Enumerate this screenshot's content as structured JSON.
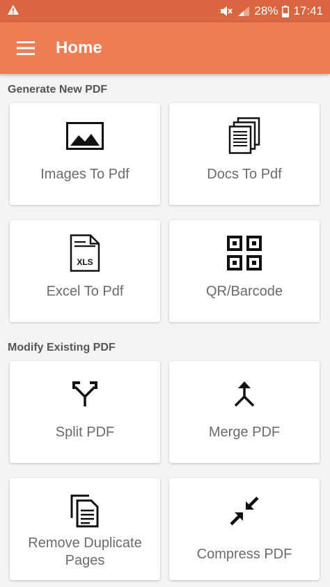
{
  "status_bar": {
    "battery_percent": "28%",
    "time": "17:41",
    "icons": [
      "warning-icon",
      "mute-icon",
      "signal-icon",
      "battery-icon"
    ]
  },
  "app_bar": {
    "title": "Home",
    "menu_icon": "hamburger-menu-icon"
  },
  "sections": {
    "generate": {
      "title": "Generate New PDF",
      "cards": [
        {
          "label": "Images To Pdf",
          "icon": "image-icon"
        },
        {
          "label": "Docs To Pdf",
          "icon": "documents-icon"
        },
        {
          "label": "Excel To Pdf",
          "icon": "xls-file-icon",
          "icon_text": "XLS"
        },
        {
          "label": "QR/Barcode",
          "icon": "qr-code-icon"
        }
      ]
    },
    "modify": {
      "title": "Modify Existing PDF",
      "cards": [
        {
          "label": "Split PDF",
          "icon": "split-icon"
        },
        {
          "label": "Merge PDF",
          "icon": "merge-icon"
        },
        {
          "label": "Remove Duplicate Pages",
          "icon": "copy-pages-icon"
        },
        {
          "label": "Compress PDF",
          "icon": "compress-icon"
        }
      ]
    }
  },
  "colors": {
    "status_bar": "#d9663f",
    "app_bar": "#ed7e53",
    "background": "#f4f4f4",
    "card": "#ffffff",
    "label_text": "#6b6b6b",
    "section_text": "#555555"
  }
}
